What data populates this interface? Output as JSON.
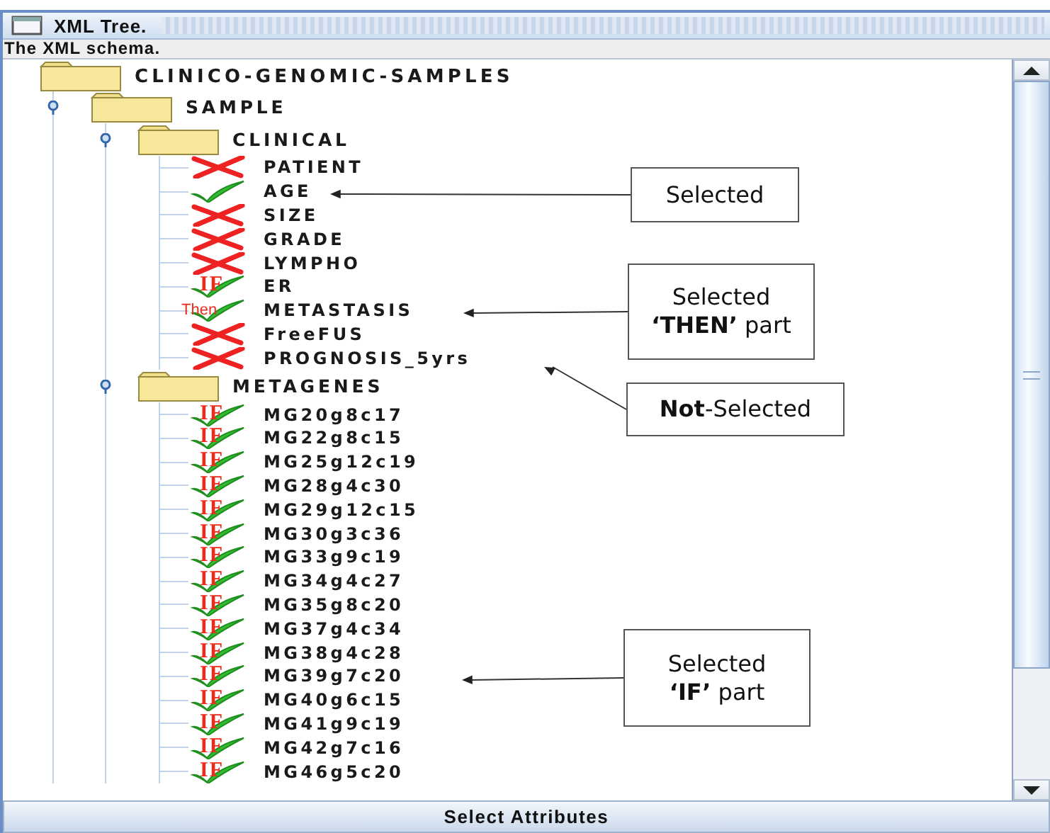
{
  "window": {
    "title": "XML Tree."
  },
  "header": "The XML schema.",
  "tree": {
    "label": "CLINICO-GENOMIC-SAMPLES",
    "children": [
      {
        "label": "SAMPLE",
        "expanded": true,
        "children": [
          {
            "label": "CLINICAL",
            "expanded": true,
            "children": [
              {
                "label": "PATIENT",
                "kind": "excluded"
              },
              {
                "label": "AGE",
                "kind": "selected"
              },
              {
                "label": "SIZE",
                "kind": "excluded"
              },
              {
                "label": "GRADE",
                "kind": "excluded"
              },
              {
                "label": "LYMPHO",
                "kind": "excluded"
              },
              {
                "label": "ER",
                "kind": "if",
                "tag": "IF"
              },
              {
                "label": "METASTASIS",
                "kind": "then",
                "tag": "Then"
              },
              {
                "label": "FreeFUS",
                "kind": "excluded"
              },
              {
                "label": "PROGNOSIS_5yrs",
                "kind": "excluded"
              }
            ]
          },
          {
            "label": "METAGENES",
            "expanded": true,
            "children": [
              {
                "label": "MG20g8c17",
                "kind": "if",
                "tag": "IF"
              },
              {
                "label": "MG22g8c15",
                "kind": "if",
                "tag": "IF"
              },
              {
                "label": "MG25g12c19",
                "kind": "if",
                "tag": "IF"
              },
              {
                "label": "MG28g4c30",
                "kind": "if",
                "tag": "IF"
              },
              {
                "label": "MG29g12c15",
                "kind": "if",
                "tag": "IF"
              },
              {
                "label": "MG30g3c36",
                "kind": "if",
                "tag": "IF"
              },
              {
                "label": "MG33g9c19",
                "kind": "if",
                "tag": "IF"
              },
              {
                "label": "MG34g4c27",
                "kind": "if",
                "tag": "IF"
              },
              {
                "label": "MG35g8c20",
                "kind": "if",
                "tag": "IF"
              },
              {
                "label": "MG37g4c34",
                "kind": "if",
                "tag": "IF"
              },
              {
                "label": "MG38g4c28",
                "kind": "if",
                "tag": "IF"
              },
              {
                "label": "MG39g7c20",
                "kind": "if",
                "tag": "IF"
              },
              {
                "label": "MG40g6c15",
                "kind": "if",
                "tag": "IF"
              },
              {
                "label": "MG41g9c19",
                "kind": "if",
                "tag": "IF"
              },
              {
                "label": "MG42g7c16",
                "kind": "if",
                "tag": "IF"
              },
              {
                "label": "MG46g5c20",
                "kind": "if",
                "tag": "IF"
              }
            ]
          }
        ]
      }
    ]
  },
  "button": "Select Attributes",
  "callouts": [
    {
      "lines": [
        "Selected"
      ]
    },
    {
      "lines": [
        "Selected",
        "**‘THEN’** part"
      ]
    },
    {
      "lines": [
        "**Not**-Selected"
      ]
    },
    {
      "lines": [
        "Selected",
        "**‘IF’** part"
      ]
    }
  ]
}
